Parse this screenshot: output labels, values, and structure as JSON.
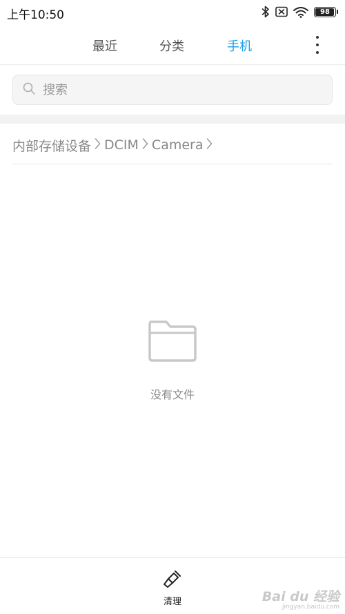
{
  "status_bar": {
    "time": "上午10:50",
    "battery": "98",
    "battery_level": 0.98,
    "icons": [
      "bluetooth-icon",
      "sim-off-icon",
      "wifi-icon",
      "battery-icon"
    ]
  },
  "tabs": [
    {
      "label": "最近",
      "active": false
    },
    {
      "label": "分类",
      "active": false
    },
    {
      "label": "手机",
      "active": true
    }
  ],
  "search": {
    "placeholder": "搜索"
  },
  "breadcrumb": {
    "items": [
      "内部存储设备",
      "DCIM",
      "Camera"
    ],
    "separator": ">"
  },
  "empty": {
    "text": "没有文件"
  },
  "bottom": {
    "clean_label": "清理"
  },
  "watermark": {
    "main": "Bai du 经验",
    "sub": "jingyan.baidu.com"
  },
  "colors": {
    "accent": "#1a9fe8",
    "text": "#333333",
    "muted": "#888888",
    "divider": "#f2f2f2"
  }
}
